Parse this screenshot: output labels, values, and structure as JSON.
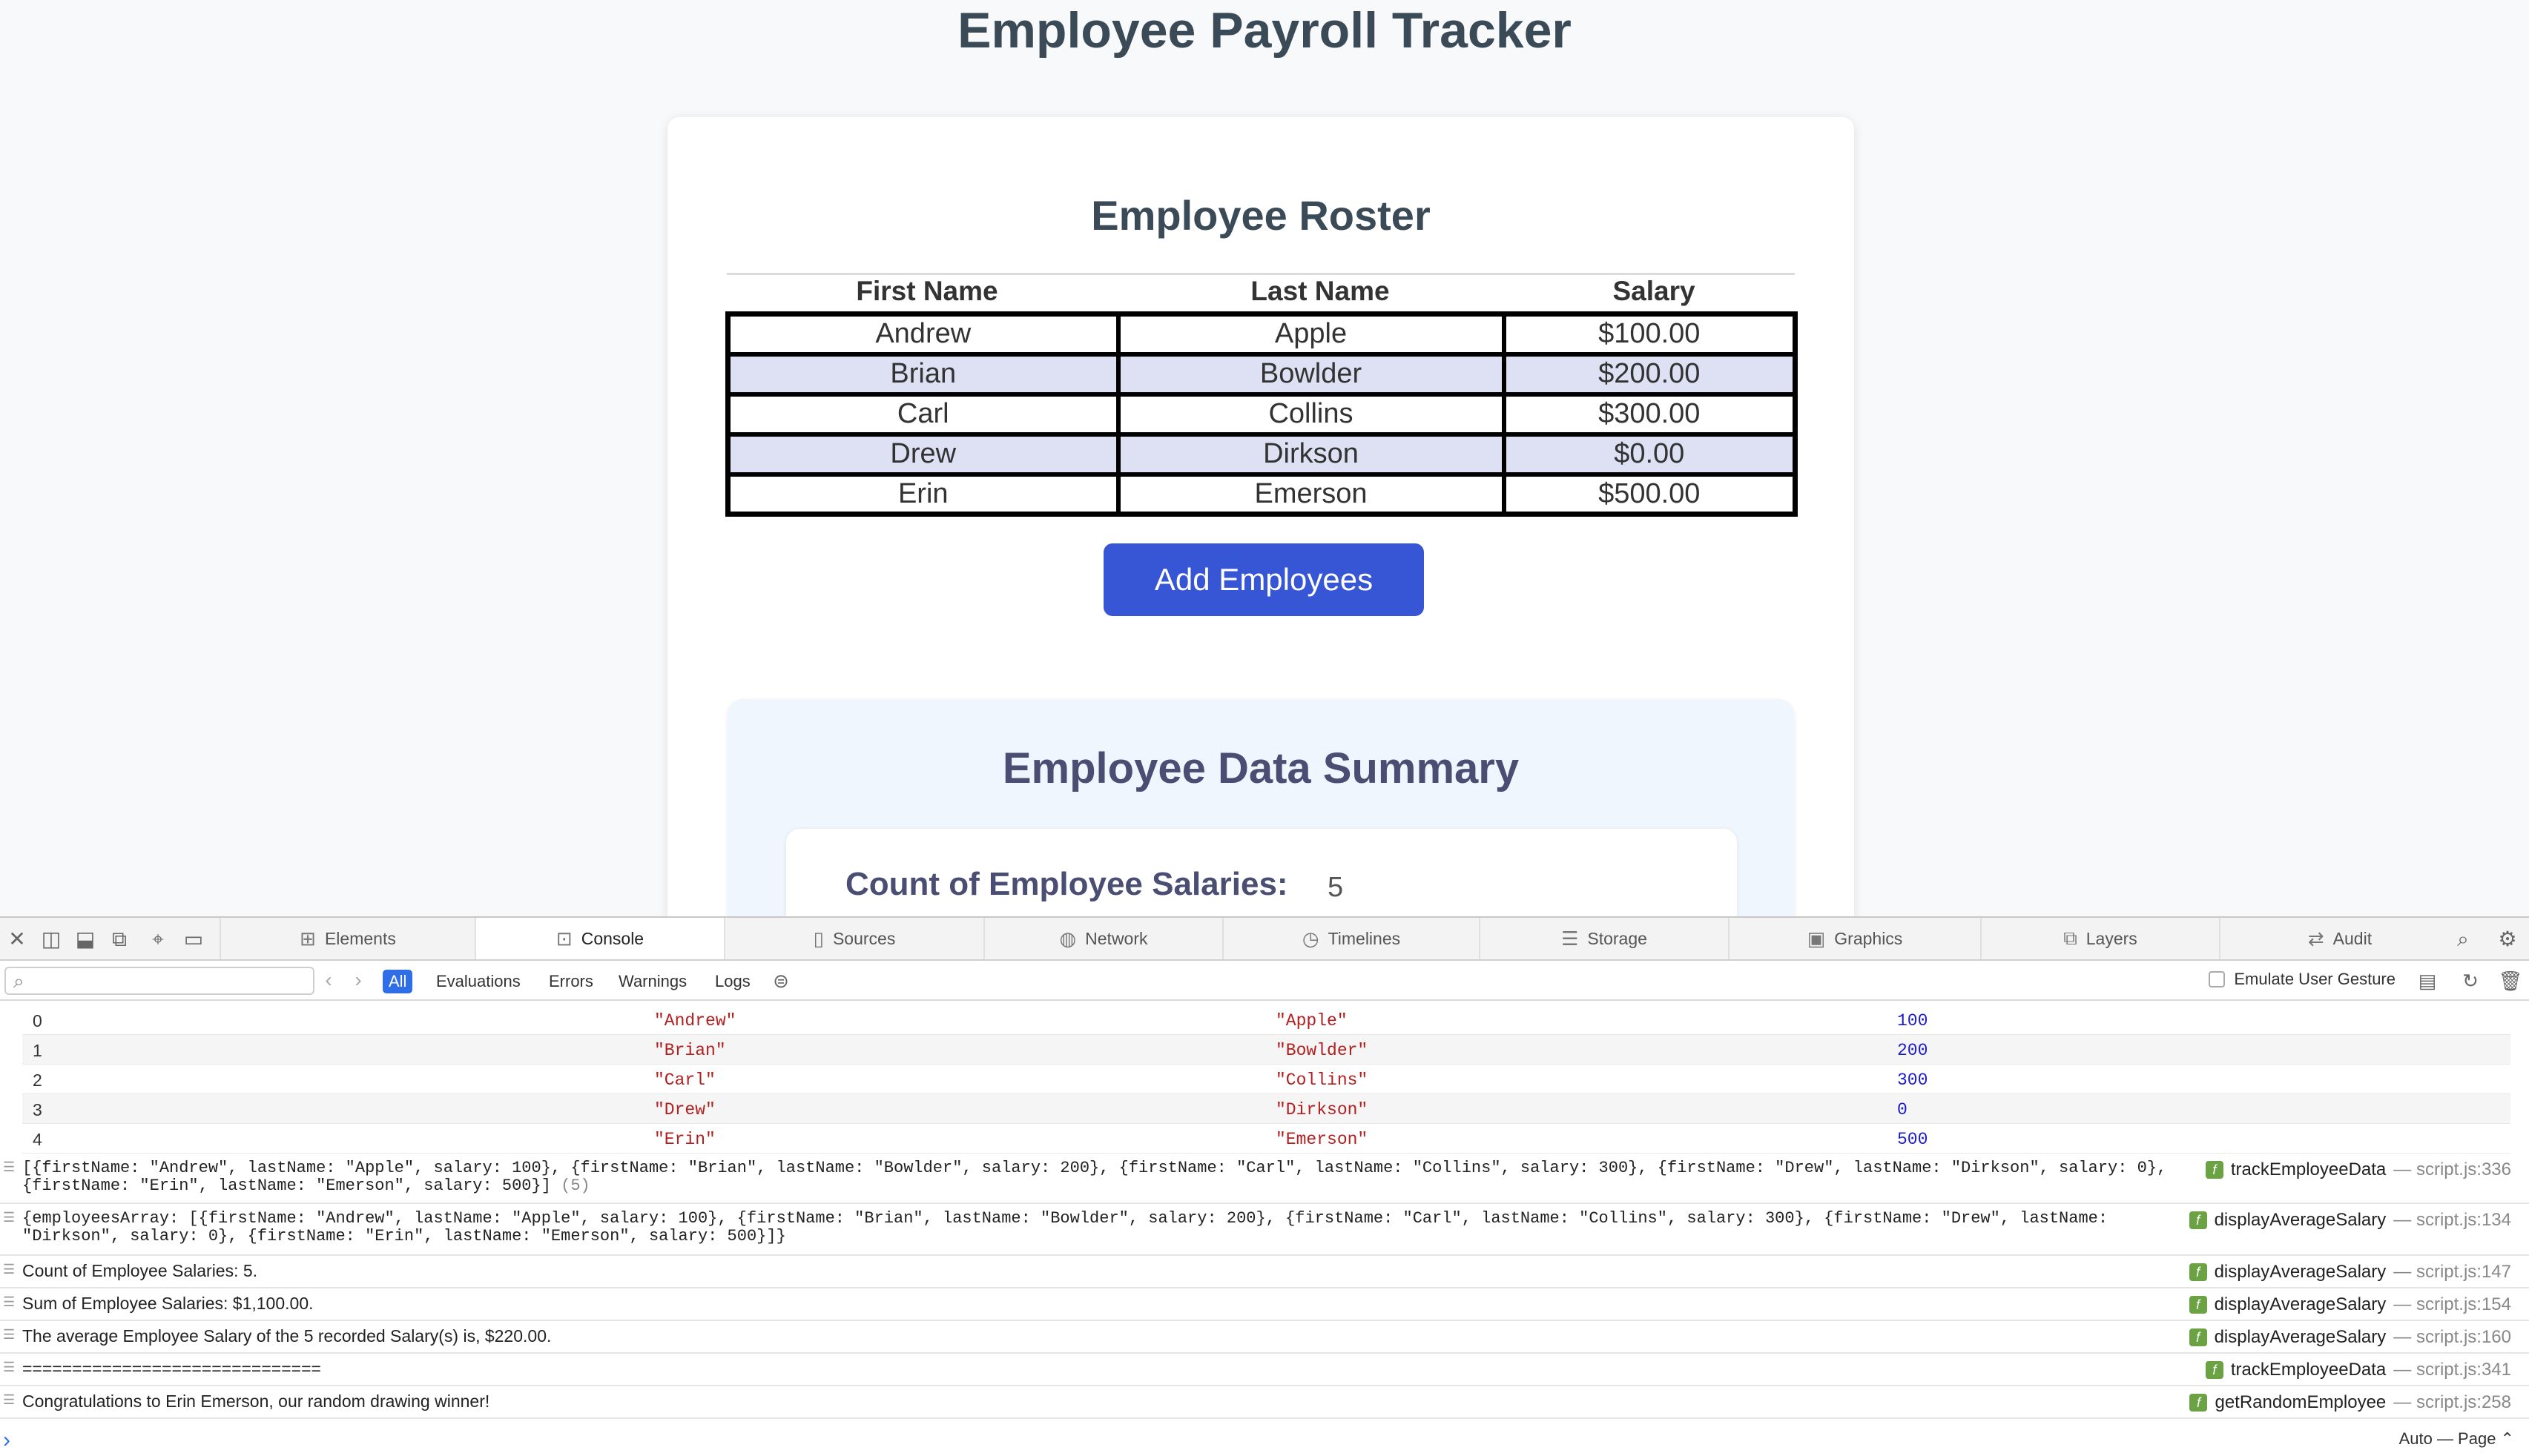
{
  "page": {
    "title": "Employee Payroll Tracker",
    "roster_title": "Employee Roster",
    "columns": [
      "First Name",
      "Last Name",
      "Salary"
    ],
    "rows": [
      [
        "Andrew",
        "Apple",
        "$100.00"
      ],
      [
        "Brian",
        "Bowlder",
        "$200.00"
      ],
      [
        "Carl",
        "Collins",
        "$300.00"
      ],
      [
        "Drew",
        "Dirkson",
        "$0.00"
      ],
      [
        "Erin",
        "Emerson",
        "$500.00"
      ]
    ],
    "add_button": "Add Employees",
    "summary_title": "Employee Data Summary",
    "count_label": "Count of Employee Salaries:",
    "count_value": "5"
  },
  "devtools": {
    "tabs": [
      "Elements",
      "Console",
      "Sources",
      "Network",
      "Timelines",
      "Storage",
      "Graphics",
      "Layers",
      "Audit"
    ],
    "active_tab": "Console",
    "filters": [
      "All",
      "Evaluations",
      "Errors",
      "Warnings",
      "Logs"
    ],
    "emulate_label": "Emulate User Gesture",
    "array_rows": [
      [
        "0",
        "\"Andrew\"",
        "\"Apple\"",
        "100"
      ],
      [
        "1",
        "\"Brian\"",
        "\"Bowlder\"",
        "200"
      ],
      [
        "2",
        "\"Carl\"",
        "\"Collins\"",
        "300"
      ],
      [
        "3",
        "\"Drew\"",
        "\"Dirkson\"",
        "0"
      ],
      [
        "4",
        "\"Erin\"",
        "\"Emerson\"",
        "500"
      ]
    ],
    "logs": [
      {
        "line1": "[{firstName: \"Andrew\", lastName: \"Apple\", salary: 100}, {firstName: \"Brian\", lastName: \"Bowlder\", salary: 200}, {firstName: \"Carl\", lastName: \"Collins\", salary: 300}, {firstName: \"Drew\", lastName: \"Dirkson\", salary: 0},",
        "line2": "{firstName: \"Erin\", lastName: \"Emerson\", salary: 500}]",
        "suffix": "(5)",
        "fn": "trackEmployeeData",
        "loc": "— script.js:336"
      },
      {
        "line1": "{employeesArray: [{firstName: \"Andrew\", lastName: \"Apple\", salary: 100}, {firstName: \"Brian\", lastName: \"Bowlder\", salary: 200}, {firstName: \"Carl\", lastName: \"Collins\", salary: 300}, {firstName: \"Drew\", lastName:",
        "line2": "\"Dirkson\", salary: 0}, {firstName: \"Erin\", lastName: \"Emerson\", salary: 500}]}",
        "fn": "displayAverageSalary",
        "loc": "— script.js:134"
      },
      {
        "text": "Count of Employee Salaries: 5.",
        "fn": "displayAverageSalary",
        "loc": "— script.js:147"
      },
      {
        "text": "Sum of Employee Salaries: $1,100.00.",
        "fn": "displayAverageSalary",
        "loc": "— script.js:154"
      },
      {
        "text": "The average Employee Salary of the 5 recorded Salary(s) is, $220.00.",
        "fn": "displayAverageSalary",
        "loc": "— script.js:160"
      },
      {
        "text": "==============================",
        "fn": "trackEmployeeData",
        "loc": "— script.js:341"
      },
      {
        "text": "Congratulations to Erin Emerson, our random drawing winner!",
        "fn": "getRandomEmployee",
        "loc": "— script.js:258"
      }
    ],
    "prompt": "›",
    "page_mode": "Auto — Page ⌃"
  },
  "colors": {
    "button": "#3656d6",
    "stripe": "#dde1f3",
    "filter_active": "#2f6ee6",
    "function_badge": "#6ba344"
  },
  "icons": [
    "close-icon",
    "dock-left-icon",
    "dock-bottom-icon",
    "detach-icon",
    "target-icon",
    "device-icon",
    "search-icon",
    "settings-icon",
    "filter-icon",
    "clear-icon",
    "function-icon"
  ]
}
